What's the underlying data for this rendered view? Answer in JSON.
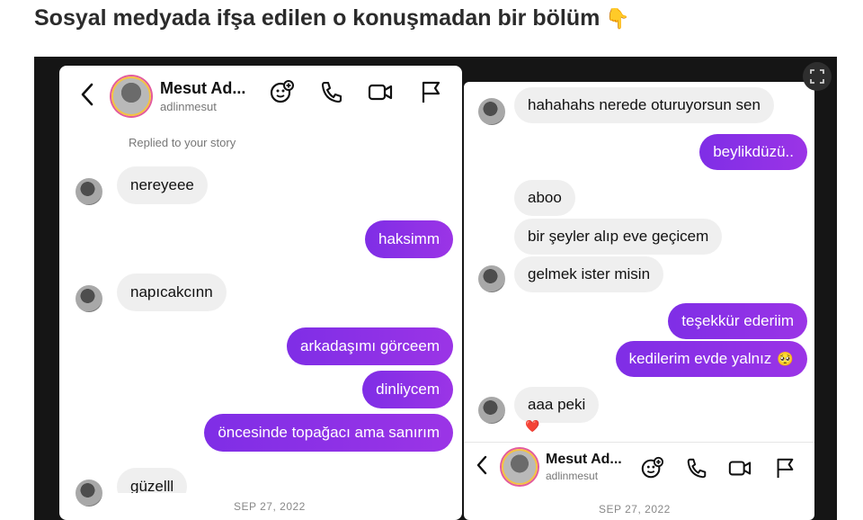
{
  "headline": {
    "text": "Sosyal medyada ifşa edilen o konuşmadan bir bölüm",
    "emoji": "👇"
  },
  "left": {
    "contact_name": "Mesut Ad...",
    "username": "adlinmesut",
    "replied_note": "Replied to your story",
    "messages": [
      {
        "side": "in",
        "text": "nereyeee"
      },
      {
        "side": "out",
        "text": "haksimm"
      },
      {
        "side": "in",
        "text": "napıcakcınn"
      },
      {
        "side": "out",
        "text": "arkadaşımı görceem"
      },
      {
        "side": "out",
        "text": "dinliycem"
      },
      {
        "side": "out",
        "text": "öncesinde topağacı ama sanırım"
      },
      {
        "side": "in",
        "text": "güzelll"
      }
    ],
    "date": "SEP 27, 2022"
  },
  "right": {
    "messages": [
      {
        "side": "in",
        "text": "hahahahs nerede oturuyorsun sen"
      },
      {
        "side": "out",
        "text": "beylikdüzü.."
      },
      {
        "side": "in",
        "text": "aboo"
      },
      {
        "side": "in",
        "text": "bir şeyler alıp eve geçicem"
      },
      {
        "side": "in",
        "text": "gelmek ister misin"
      },
      {
        "side": "out",
        "text": "teşekkür ederiim"
      },
      {
        "side": "out",
        "text": "kedilerim evde yalnız",
        "emoji": "🥺"
      },
      {
        "side": "in",
        "text": "aaa peki"
      }
    ],
    "reaction": "❤️",
    "contact_name": "Mesut Ad...",
    "username": "adlinmesut",
    "date": "SEP 27, 2022"
  },
  "colors": {
    "outgoing": "#8e2de2",
    "incoming": "#efefef",
    "frame": "#151515"
  },
  "icons": [
    "back-chevron-icon",
    "sticker-add-icon",
    "phone-icon",
    "video-icon",
    "flag-icon",
    "expand-icon",
    "heart-reaction-icon"
  ]
}
